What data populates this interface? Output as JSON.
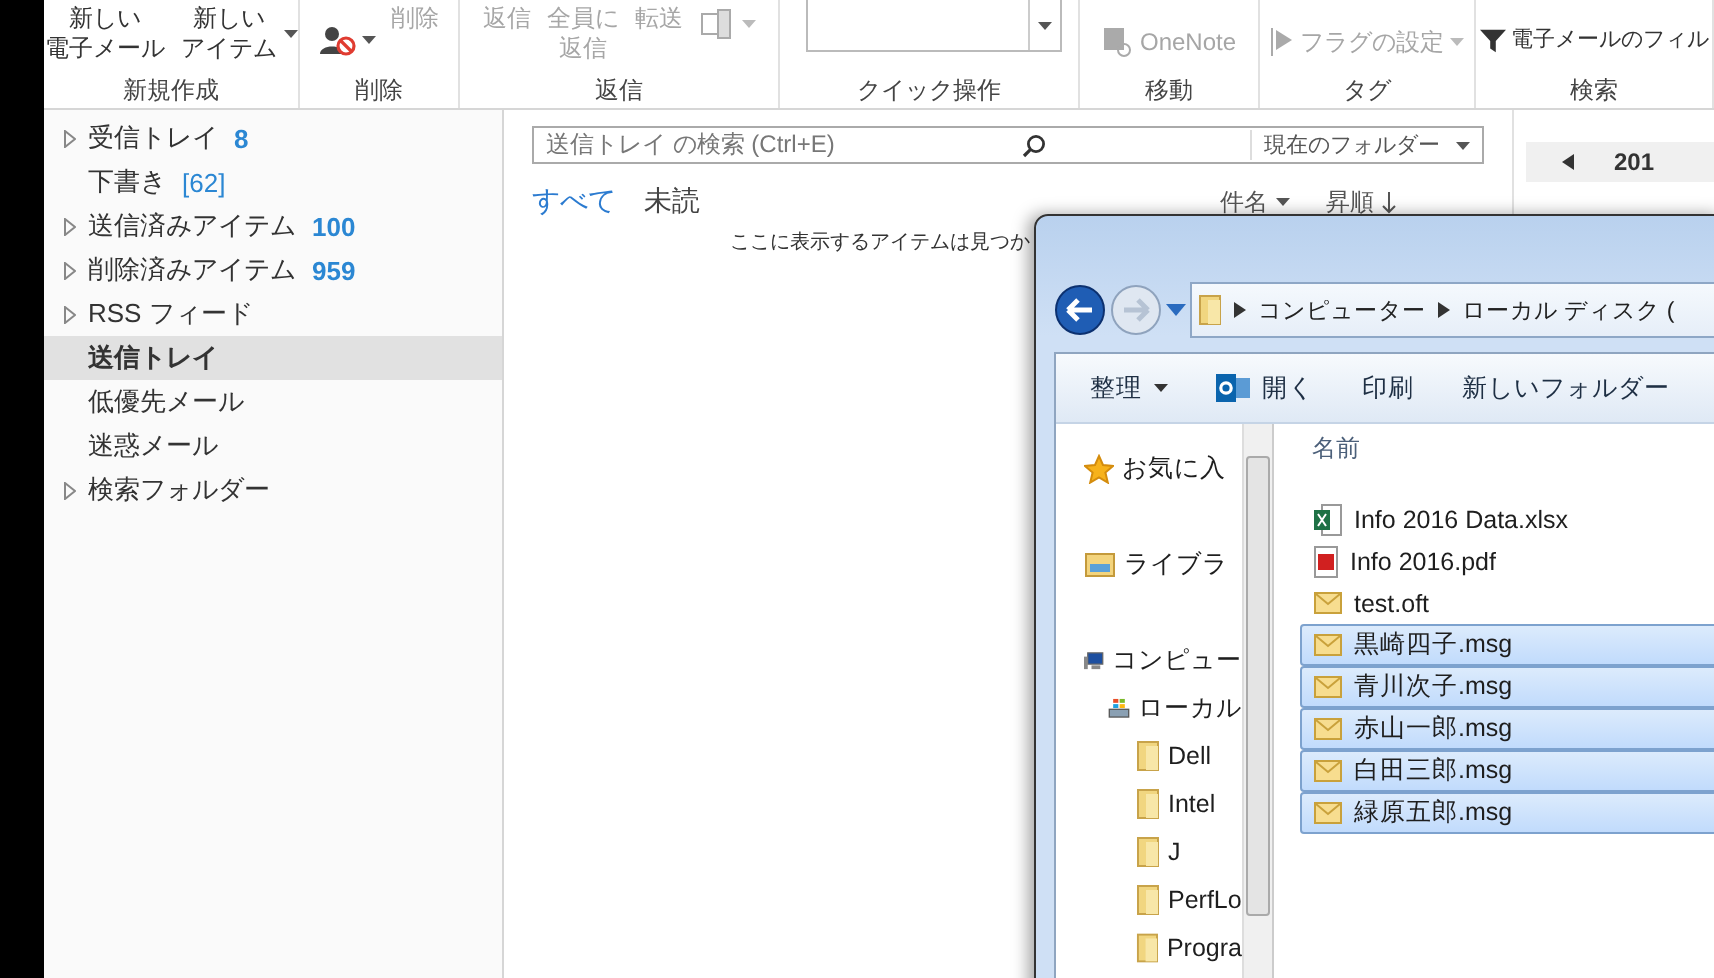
{
  "ribbon": {
    "groups": [
      {
        "label": "新規作成",
        "buttons": [
          {
            "kind": "text",
            "lines": [
              "新しい",
              "電子メール"
            ],
            "disabled": false,
            "dropdown": false
          },
          {
            "kind": "text",
            "lines": [
              "新しい",
              "アイテム"
            ],
            "disabled": false,
            "dropdown": true
          }
        ]
      },
      {
        "label": "削除",
        "buttons": [
          {
            "kind": "ignore",
            "disabled": false,
            "dropdown": true
          },
          {
            "kind": "text",
            "lines": [
              "削除"
            ],
            "disabled": true,
            "dropdown": false
          }
        ]
      },
      {
        "label": "返信",
        "buttons": [
          {
            "kind": "text",
            "lines": [
              "返信"
            ],
            "disabled": true,
            "dropdown": false
          },
          {
            "kind": "text",
            "lines": [
              "全員に",
              "返信"
            ],
            "disabled": true,
            "dropdown": false
          },
          {
            "kind": "text",
            "lines": [
              "転送"
            ],
            "disabled": true,
            "dropdown": false
          },
          {
            "kind": "more",
            "disabled": true,
            "dropdown": true
          }
        ]
      },
      {
        "label": "クイック操作",
        "buttons": [
          {
            "kind": "gallery"
          }
        ]
      },
      {
        "label": "移動",
        "buttons": [
          {
            "kind": "onenote",
            "lines": [
              "OneNote"
            ],
            "disabled": true,
            "dropdown": false
          }
        ]
      },
      {
        "label": "タグ",
        "buttons": [
          {
            "kind": "flag",
            "lines": [
              "フラグの設定"
            ],
            "disabled": true,
            "dropdown": true
          }
        ]
      },
      {
        "label": "検索",
        "buttons": [
          {
            "kind": "filter",
            "lines": [
              "電子メールのフィル"
            ],
            "disabled": false,
            "dropdown": false
          }
        ]
      }
    ]
  },
  "folders": [
    {
      "name": "受信トレイ",
      "count": "8",
      "count_bold": true,
      "expandable": true,
      "selected": false
    },
    {
      "name": "下書き",
      "count": "[62]",
      "count_bold": false,
      "expandable": false,
      "selected": false
    },
    {
      "name": "送信済みアイテム",
      "count": "100",
      "count_bold": true,
      "expandable": true,
      "selected": false
    },
    {
      "name": "削除済みアイテム",
      "count": "959",
      "count_bold": true,
      "expandable": true,
      "selected": false
    },
    {
      "name": "RSS フィード",
      "expandable": true,
      "selected": false
    },
    {
      "name": "送信トレイ",
      "expandable": false,
      "selected": true
    },
    {
      "name": "低優先メール",
      "expandable": false,
      "selected": false
    },
    {
      "name": "迷惑メール",
      "expandable": false,
      "selected": false
    },
    {
      "name": "検索フォルダー",
      "expandable": true,
      "selected": false
    }
  ],
  "message_list": {
    "search": {
      "placeholder": "送信トレイ の検索 (Ctrl+E)",
      "scope": "現在のフォルダー"
    },
    "filters": [
      {
        "label": "すべて",
        "selected": true
      },
      {
        "label": "未読",
        "selected": false
      }
    ],
    "sort": {
      "field": "件名",
      "order": "昇順"
    },
    "empty_message": "ここに表示するアイテムは見つか"
  },
  "calendar": {
    "month": "201"
  },
  "explorer": {
    "address": [
      "コンピューター",
      "ローカル ディスク ("
    ],
    "toolbar": [
      {
        "label": "整理",
        "kind": "menu"
      },
      {
        "label": "開く",
        "kind": "outlook"
      },
      {
        "label": "印刷",
        "kind": "plain"
      },
      {
        "label": "新しいフォルダー",
        "kind": "plain"
      }
    ],
    "nav": [
      {
        "label": "お気に入",
        "kind": "star"
      },
      {
        "label": "ライブラ",
        "kind": "library"
      },
      {
        "label": "コンピュー",
        "kind": "computer",
        "children": [
          {
            "label": "ローカル",
            "kind": "drive",
            "children": [
              {
                "label": "Dell",
                "kind": "folder"
              },
              {
                "label": "Intel",
                "kind": "folder"
              },
              {
                "label": "J",
                "kind": "folder"
              },
              {
                "label": "PerfLo",
                "kind": "folder"
              },
              {
                "label": "Progra",
                "kind": "folder"
              }
            ]
          }
        ]
      }
    ],
    "column": "名前",
    "files": [
      {
        "name": "Info 2016 Data.xlsx",
        "kind": "excel",
        "selected": false
      },
      {
        "name": "Info 2016.pdf",
        "kind": "pdf",
        "selected": false
      },
      {
        "name": "test.oft",
        "kind": "mail",
        "selected": false
      },
      {
        "name": "黒崎四子.msg",
        "kind": "mail",
        "selected": true
      },
      {
        "name": "青川次子.msg",
        "kind": "mail",
        "selected": true
      },
      {
        "name": "赤山一郎.msg",
        "kind": "mail",
        "selected": true
      },
      {
        "name": "白田三郎.msg",
        "kind": "mail",
        "selected": true
      },
      {
        "name": "緑原五郎.msg",
        "kind": "mail",
        "selected": true
      }
    ]
  }
}
